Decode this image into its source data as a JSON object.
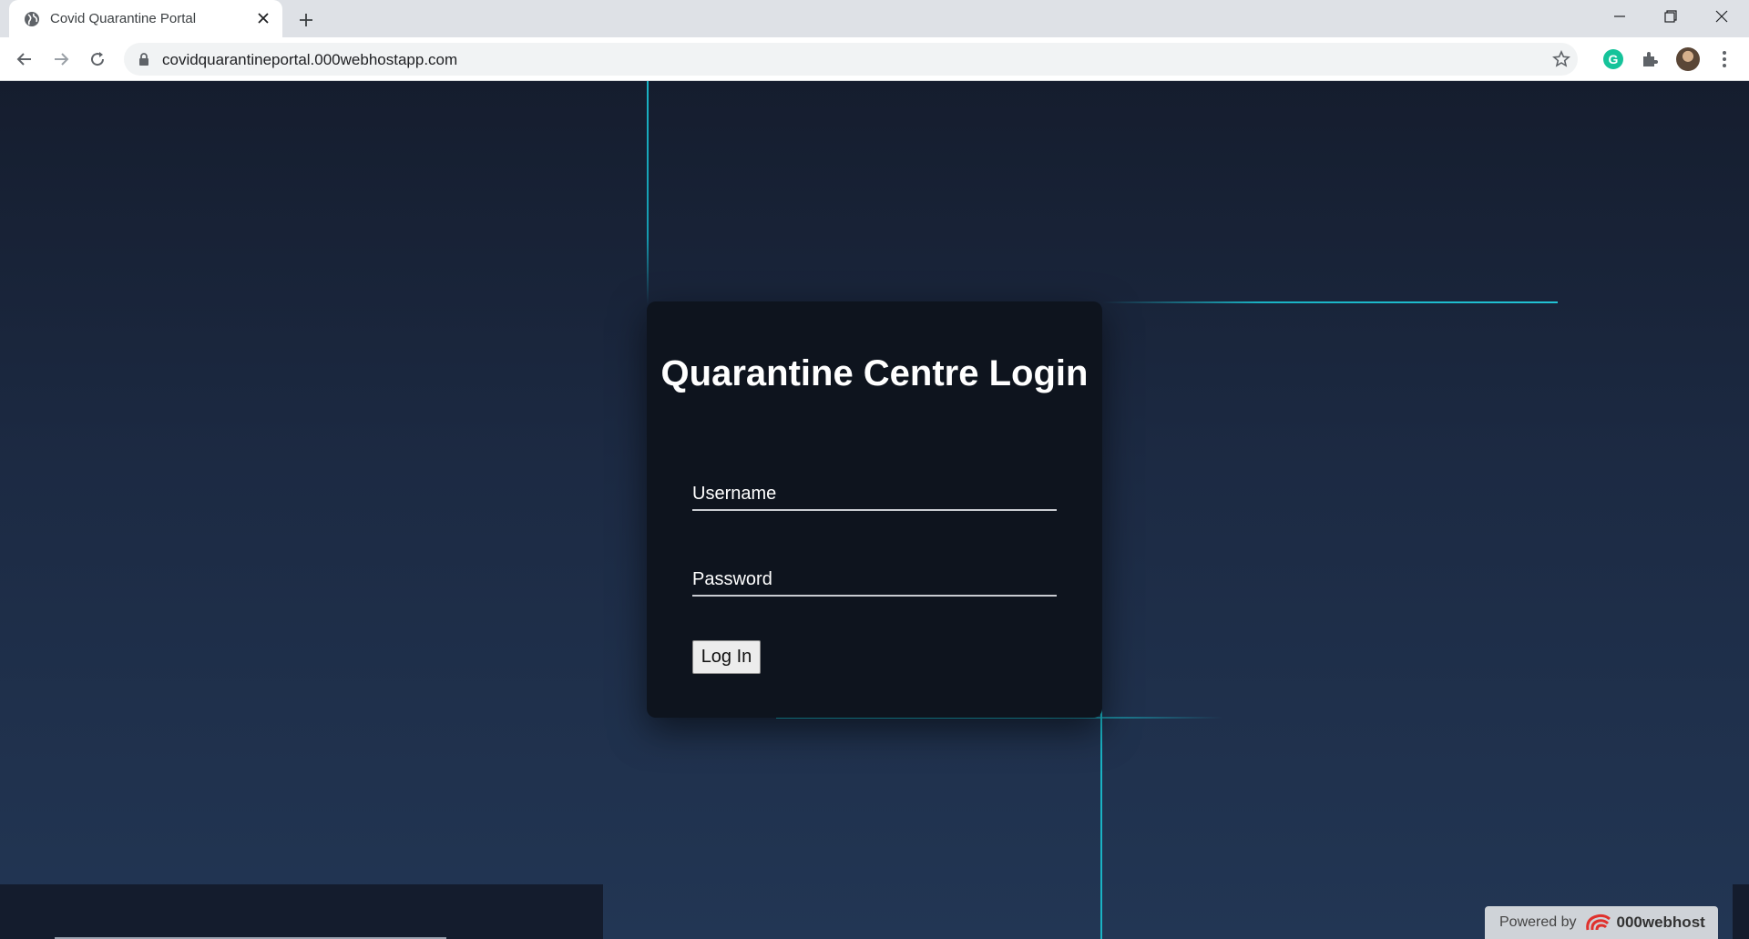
{
  "browser": {
    "tab_title": "Covid Quarantine Portal",
    "url": "covidquarantineportal.000webhostapp.com",
    "extension_letter": "G"
  },
  "login": {
    "title": "Quarantine Centre Login",
    "username_label": "Username",
    "username_value": "",
    "password_label": "Password",
    "password_value": "",
    "submit_label": "Log In"
  },
  "footer": {
    "powered_by": "Powered by",
    "brand": "000webhost"
  },
  "colors": {
    "accent_glow": "#1ab3c4",
    "card_bg": "#0e141e",
    "page_bg": "#1c2a43"
  }
}
